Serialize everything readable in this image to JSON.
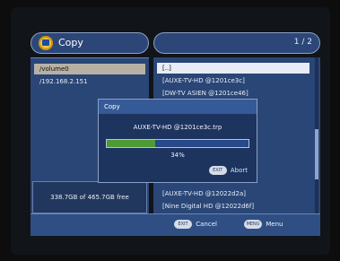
{
  "header": {
    "title": "Copy",
    "page": "1 / 2"
  },
  "left": {
    "items": [
      {
        "label": "/volume0",
        "selected": true
      },
      {
        "label": "/192.168.2.151",
        "selected": false
      }
    ],
    "free_space": "338.7GB of 465.7GB free"
  },
  "right": {
    "items": [
      {
        "label": "[..]",
        "selected": true
      },
      {
        "label": "[AUXE-TV-HD @1201ce3c]",
        "selected": false
      },
      {
        "label": "[DW-TV ASIEN @1201ce46]",
        "selected": false
      },
      {
        "label": "[AUXE-TV-HD @12022d2a]",
        "selected": false
      },
      {
        "label": "[Nine Digital HD @12022d6f]",
        "selected": false
      }
    ]
  },
  "modal": {
    "title": "Copy",
    "file": "AUXE-TV-HD @1201ce3c.trp",
    "progress_percent": 34,
    "progress_label": "34%",
    "abort_key": "EXIT",
    "abort_label": "Abort"
  },
  "footer": {
    "cancel_key": "EXIT",
    "cancel_label": "Cancel",
    "menu_key": "MENU",
    "menu_label": "Menu"
  },
  "colors": {
    "background": "#111418",
    "panel": "#2a4676",
    "accent": "#8aa1c7",
    "progress": "#4f9a35"
  }
}
